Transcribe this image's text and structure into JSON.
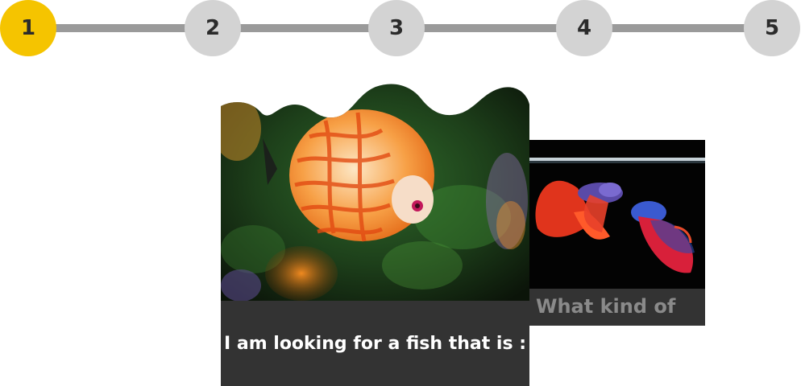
{
  "stepper": {
    "steps": [
      {
        "label": "1",
        "active": true
      },
      {
        "label": "2",
        "active": false
      },
      {
        "label": "3",
        "active": false
      },
      {
        "label": "4",
        "active": false
      },
      {
        "label": "5",
        "active": false
      }
    ],
    "colors": {
      "active": "#f5c400",
      "inactive": "#d3d3d3",
      "line": "#9a9a9a"
    }
  },
  "cards": [
    {
      "caption": "I am looking for a fish that is :",
      "image": "discus-fish-photo"
    },
    {
      "caption": "What kind of",
      "image": "betta-fish-photo"
    }
  ],
  "colors": {
    "caption_bg": "#333333"
  }
}
